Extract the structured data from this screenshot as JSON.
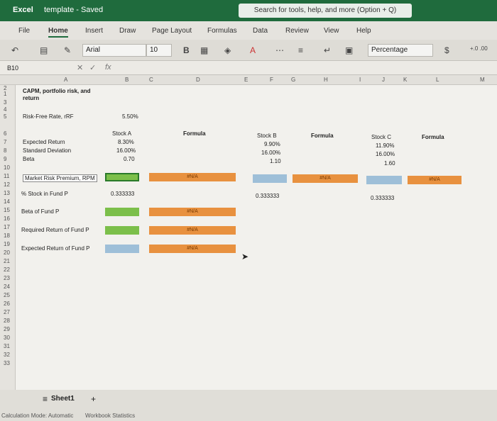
{
  "title_bar": {
    "app_name": "Excel",
    "document": "template - Saved",
    "search_placeholder": "Search for tools, help, and more (Option + Q)"
  },
  "tabs": [
    "File",
    "Home",
    "Insert",
    "Draw",
    "Page Layout",
    "Formulas",
    "Data",
    "Review",
    "View",
    "Help"
  ],
  "ribbon": {
    "font_name": "Arial",
    "font_size": "10",
    "bold": "B",
    "number_format": "Percentage",
    "currency": "$",
    "decimals": "+.0 .00"
  },
  "formula_bar": {
    "name_box": "B10",
    "fx": "fx"
  },
  "columns": [
    "A",
    "B",
    "C",
    "D",
    "E",
    "F",
    "G",
    "H",
    "I",
    "J",
    "K",
    "L",
    "M"
  ],
  "rows": [
    "1",
    "2",
    "3",
    "4",
    "5",
    "6",
    "7",
    "8",
    "9",
    "10",
    "11",
    "12",
    "13",
    "14",
    "15",
    "16",
    "17",
    "18",
    "19",
    "20",
    "21",
    "22",
    "23",
    "24",
    "25",
    "26",
    "27",
    "28",
    "29",
    "30",
    "31",
    "32",
    "33"
  ],
  "cells": {
    "a1": "CAPM, portfolio risk, and",
    "a1b": "return",
    "a3": "Risk-Free Rate, rRF",
    "b3": "5.50%",
    "b5": "Stock A",
    "d5": "Formula",
    "f5": "Stock B",
    "h5": "Formula",
    "j5": "Stock C",
    "l5": "Formula",
    "a6": "Expected Return",
    "b6": "8.30%",
    "f6": "9.90%",
    "j6": "11.90%",
    "a7": "Standard Deviation",
    "b7": "16.00%",
    "f7": "16.00%",
    "j7": "16.00%",
    "a8": "Beta",
    "b8": "0.70",
    "f8": "1.10",
    "j8": "1.60",
    "a10": "Market Risk Premium, RPM",
    "na": "#N/A",
    "a12": "% Stock in Fund P",
    "b12": "0.333333",
    "f12": "0.333333",
    "j12": "0.333333",
    "a14": "Beta of Fund P",
    "a16": "Required Return of Fund P",
    "a18": "Expected Return of Fund P"
  },
  "sheet_tab": "Sheet1",
  "status": {
    "calc": "Calculation Mode: Automatic",
    "stats": "Workbook Statistics"
  }
}
